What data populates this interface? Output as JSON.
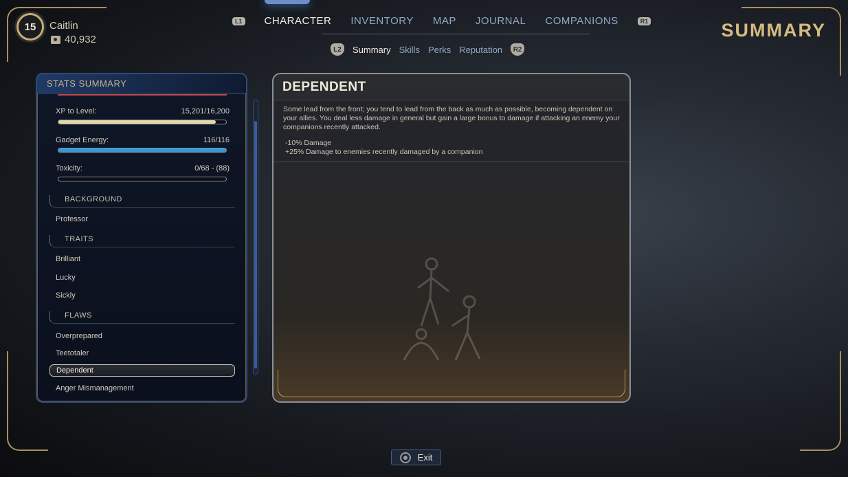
{
  "player": {
    "level": "15",
    "name": "Caitlin",
    "bits": "40,932",
    "bits_icon": "bit-currency-icon"
  },
  "nav": {
    "left_button": "L1",
    "right_button": "R1",
    "tabs": [
      {
        "label": "CHARACTER",
        "active": true
      },
      {
        "label": "INVENTORY",
        "active": false
      },
      {
        "label": "MAP",
        "active": false
      },
      {
        "label": "JOURNAL",
        "active": false
      },
      {
        "label": "COMPANIONS",
        "active": false
      }
    ]
  },
  "subnav": {
    "left_button": "L2",
    "right_button": "R2",
    "tabs": [
      {
        "label": "Summary",
        "active": true
      },
      {
        "label": "Skills",
        "active": false
      },
      {
        "label": "Perks",
        "active": false
      },
      {
        "label": "Reputation",
        "active": false
      }
    ]
  },
  "page_title": "SUMMARY",
  "stats": {
    "header": "STATS SUMMARY",
    "xp": {
      "label": "XP to Level:",
      "value": "15,201/16,200",
      "fraction": 0.938,
      "color": "#e4d8a8"
    },
    "gadget": {
      "label": "Gadget Energy:",
      "value": "116/116",
      "fraction": 1.0,
      "color": "#2f9be0"
    },
    "toxicity": {
      "label": "Toxicity:",
      "value": "0/68 - (88)",
      "fraction": 0.0,
      "color": "#8fbf6a"
    },
    "sections": [
      {
        "title": "BACKGROUND",
        "items": [
          "Professor"
        ]
      },
      {
        "title": "TRAITS",
        "items": [
          "Brilliant",
          "Lucky",
          "Sickly"
        ]
      },
      {
        "title": "FLAWS",
        "items": [
          "Overprepared",
          "Teetotaler",
          "Dependent",
          "Anger Mismanagement"
        ]
      }
    ],
    "selected": "Dependent"
  },
  "detail": {
    "title": "DEPENDENT",
    "description": "Some lead from the front; you tend to lead from the back as much as possible, becoming dependent on your allies. You deal less damage in general but gain a large bonus to damage if attacking an enemy your companions recently attacked.",
    "effects": [
      "-10% Damage",
      "+25% Damage to enemies recently damaged by a companion"
    ]
  },
  "exit": {
    "label": "Exit",
    "icon": "circle-button-icon"
  }
}
